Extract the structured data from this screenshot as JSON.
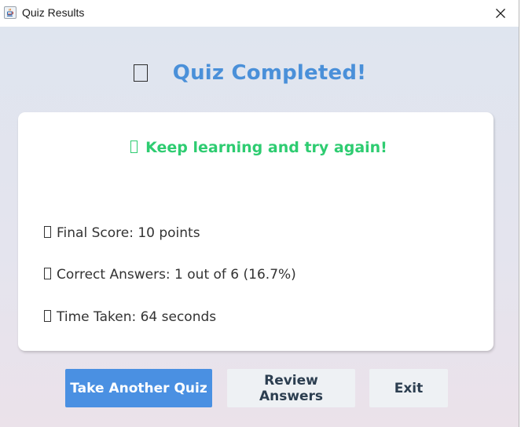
{
  "window": {
    "title": "Quiz Results",
    "app_icon": "java-icon",
    "close_icon": "close-icon"
  },
  "heading": {
    "icon": "placeholder-glyph-icon",
    "text": "Quiz Completed!",
    "color": "#4a90d9"
  },
  "card": {
    "message": "Keep learning and try again!",
    "message_color": "#2ecc71",
    "stats": [
      {
        "text": "Final Score: 10 points"
      },
      {
        "text": "Correct Answers: 1 out of 6 (16.7%)"
      },
      {
        "text": "Time Taken: 64 seconds"
      }
    ]
  },
  "buttons": {
    "take_another": "Take Another Quiz",
    "review": "Review Answers",
    "exit": "Exit",
    "primary_color": "#4a90e2"
  }
}
